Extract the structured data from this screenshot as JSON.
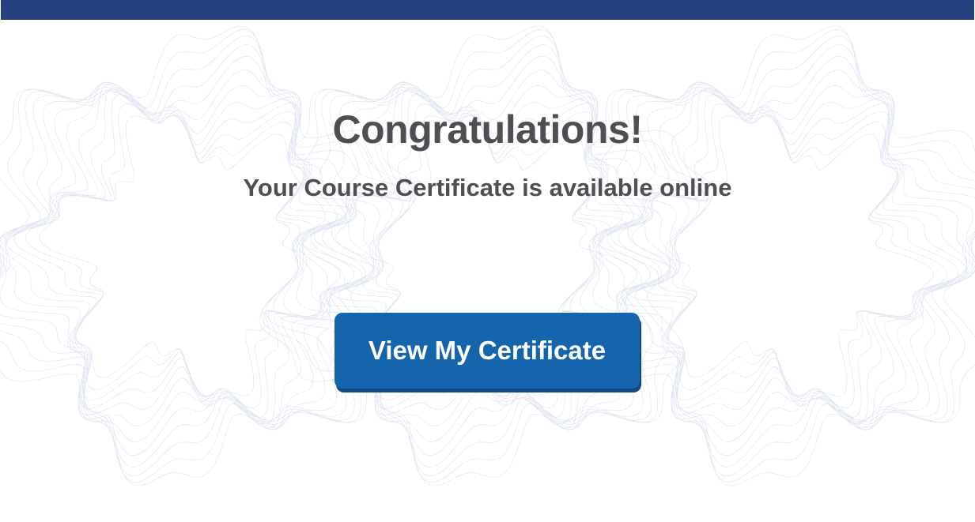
{
  "header": {
    "bar_color": "#24407f"
  },
  "main": {
    "headline": "Congratulations!",
    "subline": "Your Course Certificate is available online",
    "cta_label": "View My Certificate"
  },
  "colors": {
    "text": "#4e4f53",
    "button": "#1565ad",
    "button_shadow": "#0f4a85",
    "pattern": "#c9d2e6"
  }
}
